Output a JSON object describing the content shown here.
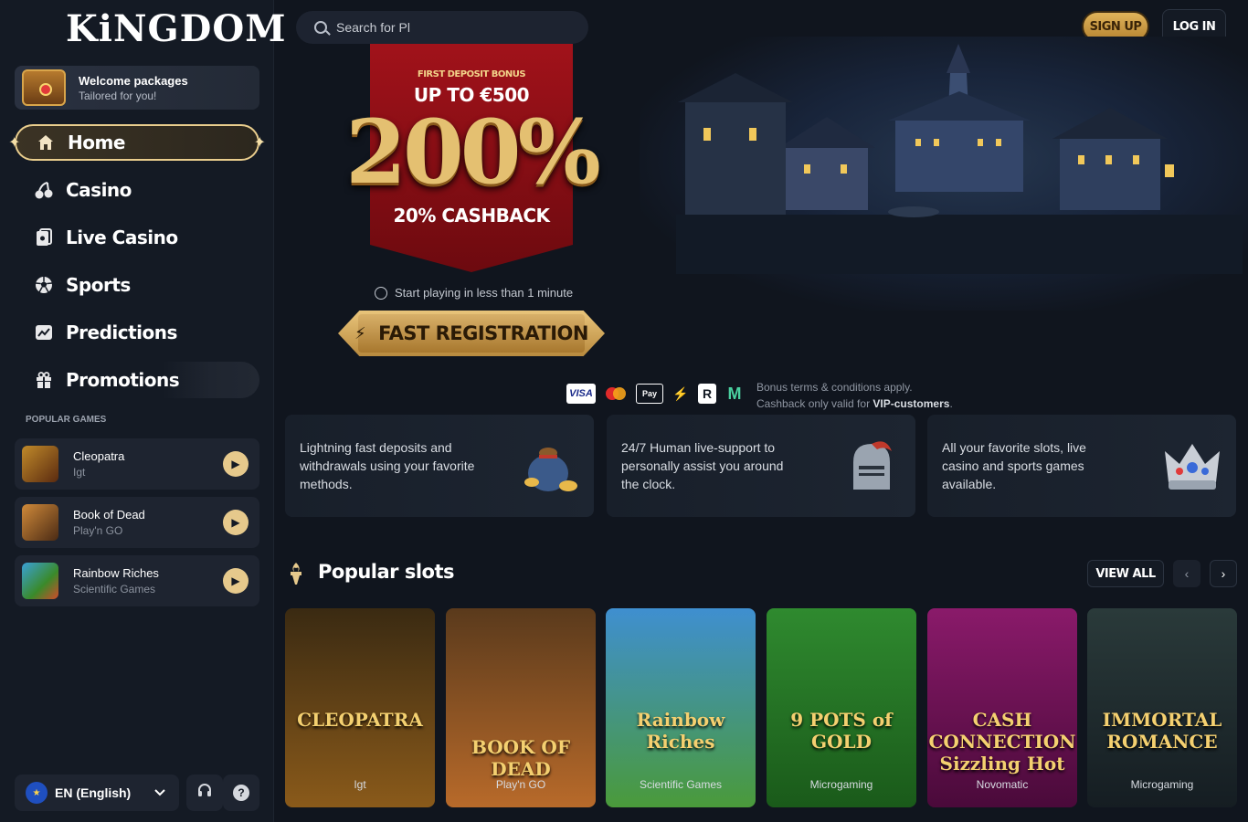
{
  "brand": {
    "logo": "KiNGDOM"
  },
  "sidebar": {
    "welcome": {
      "title": "Welcome packages",
      "subtitle": "Tailored for you!"
    },
    "nav": [
      {
        "label": "Home",
        "icon": "home-icon"
      },
      {
        "label": "Casino",
        "icon": "cherry-icon"
      },
      {
        "label": "Live Casino",
        "icon": "live-casino-icon"
      },
      {
        "label": "Sports",
        "icon": "soccer-ball-icon"
      },
      {
        "label": "Predictions",
        "icon": "chart-trend-icon"
      },
      {
        "label": "Promotions",
        "icon": "gift-icon"
      }
    ],
    "popular_label": "POPULAR GAMES",
    "popular_games": [
      {
        "name": "Cleopatra",
        "provider": "Igt"
      },
      {
        "name": "Book of Dead",
        "provider": "Play'n GO"
      },
      {
        "name": "Rainbow Riches",
        "provider": "Scientific Games"
      }
    ],
    "language": "EN (English)"
  },
  "header": {
    "search_placeholder": "Search for Pl",
    "signup": "SIGN UP",
    "login": "LOG IN"
  },
  "hero": {
    "first_deposit": "FIRST DEPOSIT BONUS",
    "up_to": "UP TO €500",
    "percent": "200%",
    "cashback": "20% CASHBACK",
    "start_note": "Start playing in less than 1 minute",
    "cta": "FAST REGISTRATION"
  },
  "payments": [
    "VISA",
    "Mastercard",
    "Apple Pay",
    "Interac",
    "R",
    "M"
  ],
  "terms": {
    "line1": "Bonus terms & conditions apply.",
    "line2_prefix": "Cashback only valid for ",
    "line2_bold": "VIP-customers",
    "line2_suffix": "."
  },
  "features": [
    "Lightning fast deposits and withdrawals using your favorite methods.",
    "24/7 Human live-support to personally assist you around the clock.",
    "All your favorite slots, live casino and sports games available."
  ],
  "popular_slots": {
    "title": "Popular slots",
    "view_all": "VIEW ALL",
    "games": [
      {
        "name": "CLEOPATRA",
        "provider": "Igt",
        "colors": [
          "#3a2a12",
          "#8a5a1a"
        ]
      },
      {
        "name": "BOOK OF DEAD",
        "provider": "Play'n GO",
        "colors": [
          "#5a3a1c",
          "#b86a2a"
        ]
      },
      {
        "name": "Rainbow Riches",
        "provider": "Scientific Games",
        "colors": [
          "#3f8fd0",
          "#4a9a3a"
        ]
      },
      {
        "name": "9 POTS of GOLD",
        "provider": "Microgaming",
        "colors": [
          "#2f8a2f",
          "#1a5a1a"
        ]
      },
      {
        "name": "CASH CONNECTION Sizzling Hot",
        "provider": "Novomatic",
        "colors": [
          "#8a1a6a",
          "#4a0a3a"
        ]
      },
      {
        "name": "IMMORTAL ROMANCE",
        "provider": "Microgaming",
        "colors": [
          "#2a3a3a",
          "#151d22"
        ]
      }
    ]
  }
}
